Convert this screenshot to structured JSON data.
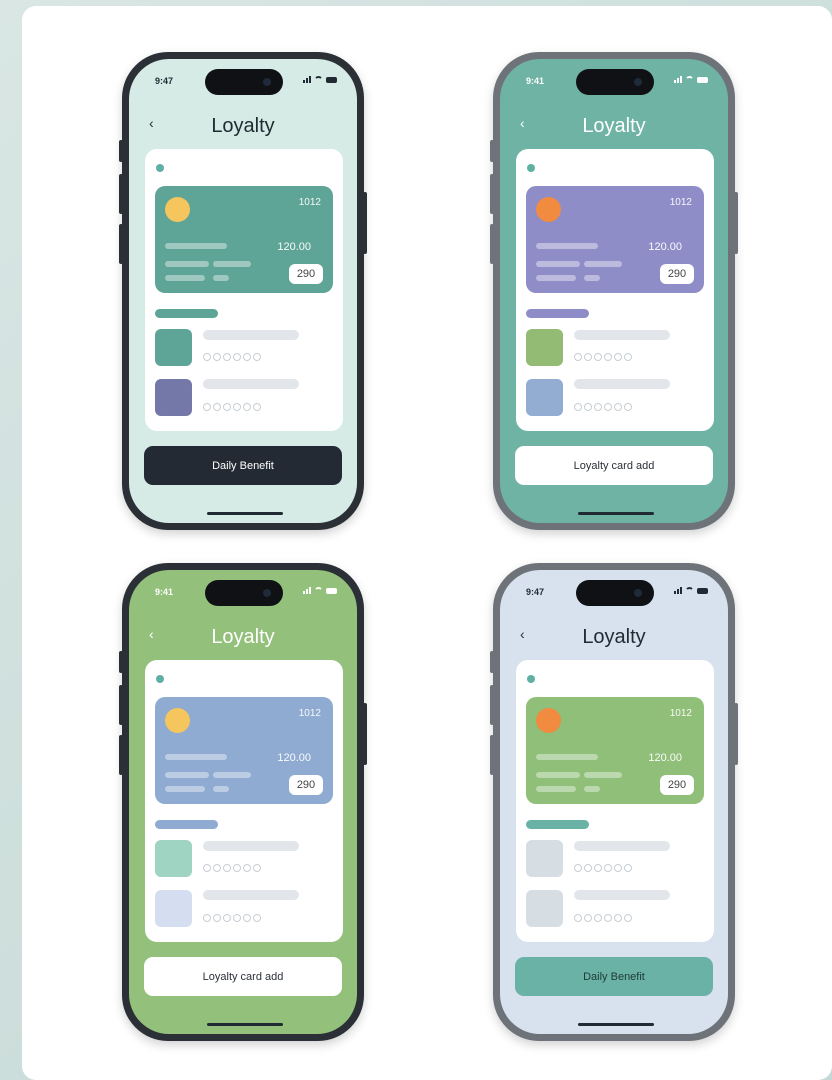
{
  "phones": [
    {
      "time": "9:47",
      "title": "Loyalty",
      "back": "‹",
      "card_number": "1012",
      "card_amount": "120.00",
      "points": "290",
      "button_label": "Daily Benefit",
      "colors": {
        "screen": "#d6ebe6",
        "card": "#5fa597",
        "coin": "#f5c55e",
        "section": "#5fa597",
        "thumb1": "#5fa597",
        "thumb2": "#7378a8",
        "button": "#232a33",
        "button_text": "#ffffff",
        "text": "#1f2a33"
      }
    },
    {
      "time": "9:41",
      "title": "Loyalty",
      "back": "‹",
      "card_number": "1012",
      "card_amount": "120.00",
      "points": "290",
      "button_label": "Loyalty card add",
      "colors": {
        "screen": "#6fb3a5",
        "card": "#8f8dc7",
        "coin": "#f08b3f",
        "section": "#8f8dc7",
        "thumb1": "#94bb74",
        "thumb2": "#93acd2",
        "button": "#ffffff",
        "button_text": "#2b3138",
        "text": "#ffffff"
      }
    },
    {
      "time": "9:41",
      "title": "Loyalty",
      "back": "‹",
      "card_number": "1012",
      "card_amount": "120.00",
      "points": "290",
      "button_label": "Loyalty card add",
      "colors": {
        "screen": "#93c07a",
        "card": "#8fabd1",
        "coin": "#f5c55e",
        "section": "#8fabd1",
        "thumb1": "#9fd4c2",
        "thumb2": "#d4def0",
        "button": "#ffffff",
        "button_text": "#2b3138",
        "text": "#ffffff"
      }
    },
    {
      "time": "9:47",
      "title": "Loyalty",
      "back": "‹",
      "card_number": "1012",
      "card_amount": "120.00",
      "points": "290",
      "button_label": "Daily Benefit",
      "colors": {
        "screen": "#d8e2ef",
        "card": "#8fbf78",
        "coin": "#f08b3f",
        "section": "#6bb2a6",
        "thumb1": "#d6dde3",
        "thumb2": "#d6dde3",
        "button": "#6bb2a6",
        "button_text": "#1f3a36",
        "text": "#1f2a33"
      }
    }
  ]
}
